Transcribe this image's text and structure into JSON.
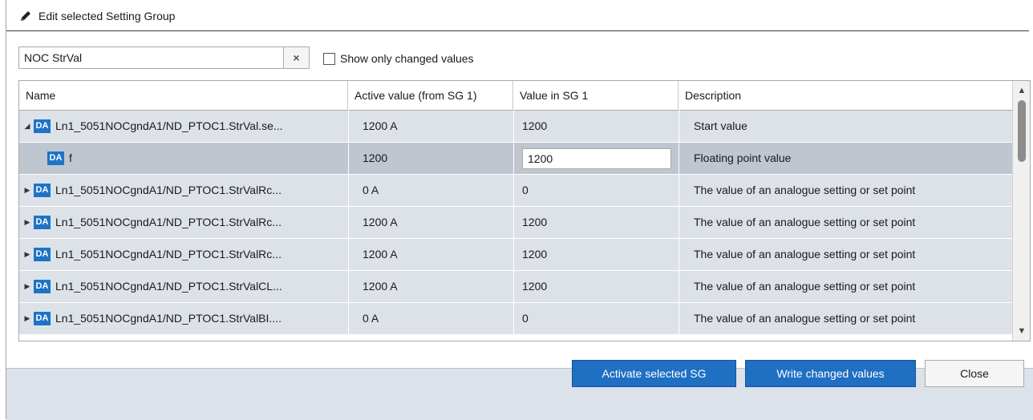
{
  "header": {
    "title": "Edit selected Setting Group",
    "icon": "pencil-icon"
  },
  "filter": {
    "value": "NOC StrVal",
    "clear_icon": "×"
  },
  "show_changed": {
    "label": "Show only changed values",
    "checked": false
  },
  "grid": {
    "columns": [
      "Name",
      "Active value (from SG 1)",
      "Value in SG 1",
      "Description"
    ],
    "rows": [
      {
        "expander": "◢",
        "badge": "DA",
        "name": "Ln1_5051NOCgndA1/ND_PTOC1.StrVal.se...",
        "active": "1200 A",
        "value": "1200",
        "description": "Start value"
      },
      {
        "expander": "",
        "badge": "DA",
        "name": "f",
        "active": "1200",
        "value": "1200",
        "description": "Floating point value",
        "editing": true
      },
      {
        "expander": "▶",
        "badge": "DA",
        "name": "Ln1_5051NOCgndA1/ND_PTOC1.StrValRc...",
        "active": "0 A",
        "value": "0",
        "description": "The value of an analogue setting or set point"
      },
      {
        "expander": "▶",
        "badge": "DA",
        "name": "Ln1_5051NOCgndA1/ND_PTOC1.StrValRc...",
        "active": "1200 A",
        "value": "1200",
        "description": "The value of an analogue setting or set point"
      },
      {
        "expander": "▶",
        "badge": "DA",
        "name": "Ln1_5051NOCgndA1/ND_PTOC1.StrValRc...",
        "active": "1200 A",
        "value": "1200",
        "description": "The value of an analogue setting or set point"
      },
      {
        "expander": "▶",
        "badge": "DA",
        "name": "Ln1_5051NOCgndA1/ND_PTOC1.StrValCL...",
        "active": "1200 A",
        "value": "1200",
        "description": "The value of an analogue setting or set point"
      },
      {
        "expander": "▶",
        "badge": "DA",
        "name": "Ln1_5051NOCgndA1/ND_PTOC1.StrValBI....",
        "active": "0 A",
        "value": "0",
        "description": "The value of an analogue setting or set point"
      }
    ]
  },
  "scrollbar": {
    "up": "▲",
    "down": "▼"
  },
  "buttons": {
    "activate": "Activate selected SG",
    "write": "Write changed values",
    "close": "Close"
  },
  "colors": {
    "accent": "#1f6fc3",
    "badge": "#1e73c8",
    "row": "#dde2e8",
    "row_selected": "#c0c6cf",
    "footer": "#dce2e9"
  }
}
